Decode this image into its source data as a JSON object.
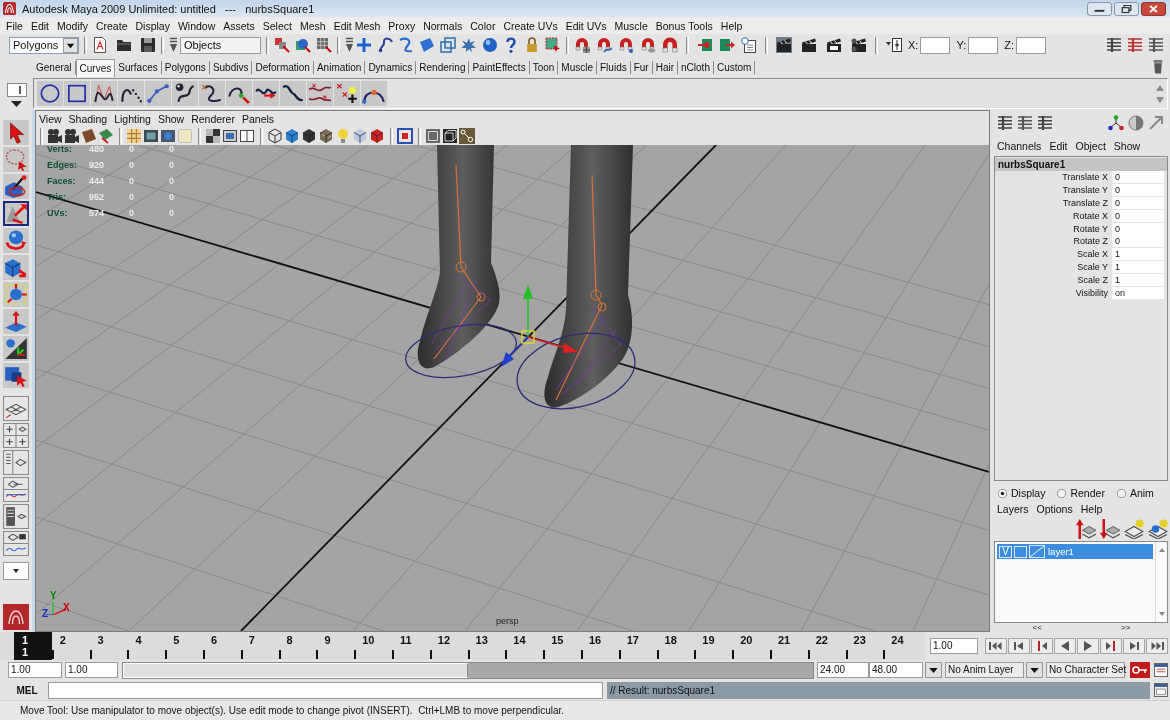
{
  "window": {
    "title": "Autodesk Maya 2009 Unlimited: untitled   ---   nurbsSquare1"
  },
  "menu_bar": [
    "File",
    "Edit",
    "Modify",
    "Create",
    "Display",
    "Window",
    "Assets",
    "Select",
    "Mesh",
    "Edit Mesh",
    "Proxy",
    "Normals",
    "Color",
    "Create UVs",
    "Edit UVs",
    "Muscle",
    "Bonus Tools",
    "Help"
  ],
  "status_line": {
    "menu_set": "Polygons",
    "selection_mode": "Objects",
    "coordinate_labels": [
      "X:",
      "Y:",
      "Z:"
    ]
  },
  "shelf": {
    "tabs": [
      {
        "label": "General",
        "selected": false
      },
      {
        "label": "Curves",
        "selected": true
      },
      {
        "label": "Surfaces",
        "selected": false
      },
      {
        "label": "Polygons",
        "selected": false
      },
      {
        "label": "Subdivs",
        "selected": false
      },
      {
        "label": "Deformation",
        "selected": false
      },
      {
        "label": "Animation",
        "selected": false
      },
      {
        "label": "Dynamics",
        "selected": false
      },
      {
        "label": "Rendering",
        "selected": false
      },
      {
        "label": "PaintEffects",
        "selected": false
      },
      {
        "label": "Toon",
        "selected": false
      },
      {
        "label": "Muscle",
        "selected": false
      },
      {
        "label": "Fluids",
        "selected": false
      },
      {
        "label": "Fur",
        "selected": false
      },
      {
        "label": "Hair",
        "selected": false
      },
      {
        "label": "nCloth",
        "selected": false
      },
      {
        "label": "Custom",
        "selected": false
      }
    ]
  },
  "toolbox": {
    "tools": [
      {
        "kind": "select",
        "selected": false
      },
      {
        "kind": "lasso",
        "selected": false
      },
      {
        "kind": "paint",
        "selected": false
      },
      {
        "kind": "move",
        "selected": true
      },
      {
        "kind": "rotate",
        "selected": false
      },
      {
        "kind": "scale",
        "selected": false
      },
      {
        "kind": "universal",
        "selected": false
      },
      {
        "kind": "soft_mod",
        "selected": false
      },
      {
        "kind": "show_manip",
        "selected": false
      },
      {
        "kind": "last_tool",
        "selected": false
      }
    ]
  },
  "viewport": {
    "menu": [
      "View",
      "Shading",
      "Lighting",
      "Show",
      "Renderer",
      "Panels"
    ],
    "hud": [
      {
        "label": "Verts:",
        "values": [
          "480",
          "0",
          "0"
        ]
      },
      {
        "label": "Edges:",
        "values": [
          "920",
          "0",
          "0"
        ]
      },
      {
        "label": "Faces:",
        "values": [
          "444",
          "0",
          "0"
        ]
      },
      {
        "label": "Tris:",
        "values": [
          "952",
          "0",
          "0"
        ]
      },
      {
        "label": "UVs:",
        "values": [
          "574",
          "0",
          "0"
        ]
      }
    ],
    "camera": "persp",
    "axis_labels": [
      {
        "label": "Y",
        "color": "#008a00"
      },
      {
        "label": "Z",
        "color": "#1030c0"
      },
      {
        "label": "X",
        "color": "#d00000"
      }
    ]
  },
  "channel_box": {
    "menu": [
      "Channels",
      "Edit",
      "Object",
      "Show"
    ],
    "object": "nurbsSquare1",
    "channels": [
      {
        "name": "Translate X",
        "value": "0"
      },
      {
        "name": "Translate Y",
        "value": "0"
      },
      {
        "name": "Translate Z",
        "value": "0"
      },
      {
        "name": "Rotate X",
        "value": "0"
      },
      {
        "name": "Rotate Y",
        "value": "0"
      },
      {
        "name": "Rotate Z",
        "value": "0"
      },
      {
        "name": "Scale X",
        "value": "1"
      },
      {
        "name": "Scale Y",
        "value": "1"
      },
      {
        "name": "Scale Z",
        "value": "1"
      },
      {
        "name": "Visibility",
        "value": "on"
      }
    ]
  },
  "layer_editor": {
    "modes": [
      {
        "label": "Display",
        "selected": true
      },
      {
        "label": "Render",
        "selected": false
      },
      {
        "label": "Anim",
        "selected": false
      }
    ],
    "menu": [
      "Layers",
      "Options",
      "Help"
    ],
    "layers": [
      {
        "visibility": "V",
        "name": "layer1",
        "selected": true
      }
    ],
    "page_buttons": [
      "<<",
      ">>"
    ]
  },
  "time_slider": {
    "frames": [
      {
        "label": "1",
        "selected": true
      },
      {
        "label": "2",
        "selected": false
      },
      {
        "label": "3",
        "selected": false
      },
      {
        "label": "4",
        "selected": false
      },
      {
        "label": "5",
        "selected": false
      },
      {
        "label": "6",
        "selected": false
      },
      {
        "label": "7",
        "selected": false
      },
      {
        "label": "8",
        "selected": false
      },
      {
        "label": "9",
        "selected": false
      },
      {
        "label": "10",
        "selected": false
      },
      {
        "label": "11",
        "selected": false
      },
      {
        "label": "12",
        "selected": false
      },
      {
        "label": "13",
        "selected": false
      },
      {
        "label": "14",
        "selected": false
      },
      {
        "label": "15",
        "selected": false
      },
      {
        "label": "16",
        "selected": false
      },
      {
        "label": "17",
        "selected": false
      },
      {
        "label": "18",
        "selected": false
      },
      {
        "label": "19",
        "selected": false
      },
      {
        "label": "20",
        "selected": false
      },
      {
        "label": "21",
        "selected": false
      },
      {
        "label": "22",
        "selected": false
      },
      {
        "label": "23",
        "selected": false
      },
      {
        "label": "24",
        "selected": false
      }
    ],
    "current_frame": "1",
    "current_time": "1.00"
  },
  "range_slider": {
    "start": "1.00",
    "range_start": "1.00",
    "range_end": "24.00",
    "end": "48.00",
    "level": 0.5
  },
  "anim_layer": "No Anim Layer",
  "character_set": "No Character Set",
  "command_line": {
    "language": "MEL",
    "result": "// Result: nurbsSquare1"
  },
  "help_line": "Move Tool: Use manipulator to move object(s). Use edit mode to change pivot (INSERT).  Ctrl+LMB to move perpendicular."
}
